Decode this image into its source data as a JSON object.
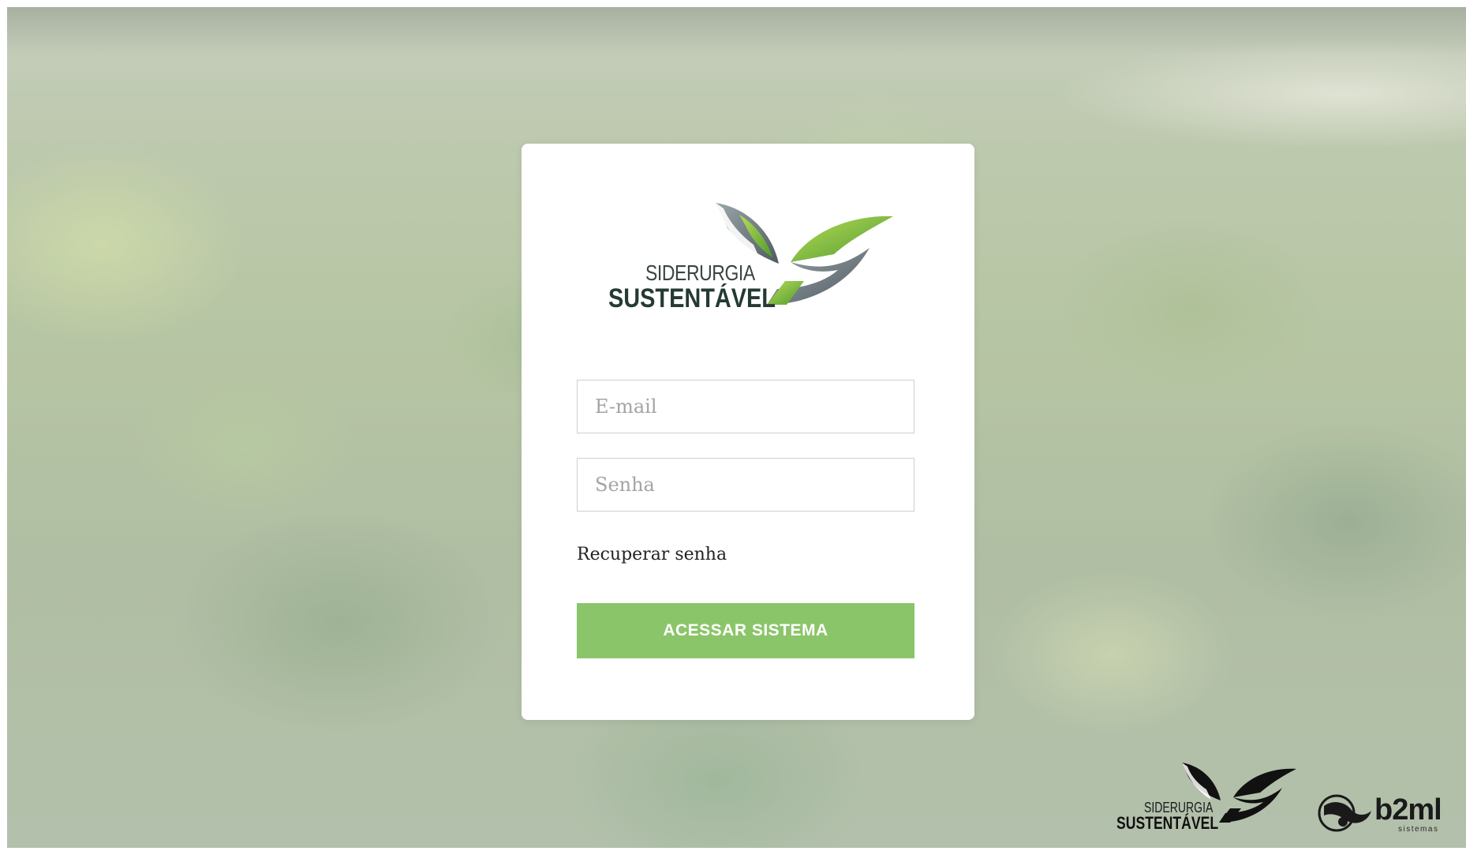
{
  "brand": {
    "logo_line_1": "SIDERURGIA",
    "logo_line_2": "SUSTENTÁVEL",
    "colors": {
      "leaf_green": "#7fbf3f",
      "leaf_grey": "#6e7b80",
      "button": "#8bc56a",
      "text_dark": "#243a33"
    }
  },
  "login": {
    "email": {
      "placeholder": "E-mail",
      "value": ""
    },
    "password": {
      "placeholder": "Senha",
      "value": ""
    },
    "recover_link": "Recuperar senha",
    "submit_label": "ACESSAR SISTEMA"
  },
  "footer": {
    "partner_logo": {
      "line_1": "SIDERURGIA",
      "line_2": "SUSTENTÁVEL"
    },
    "vendor_logo": {
      "name": "b2ml",
      "subtitle": "sistemas"
    }
  },
  "background": {
    "icon": "blurred-plant-seedlings-photo"
  }
}
